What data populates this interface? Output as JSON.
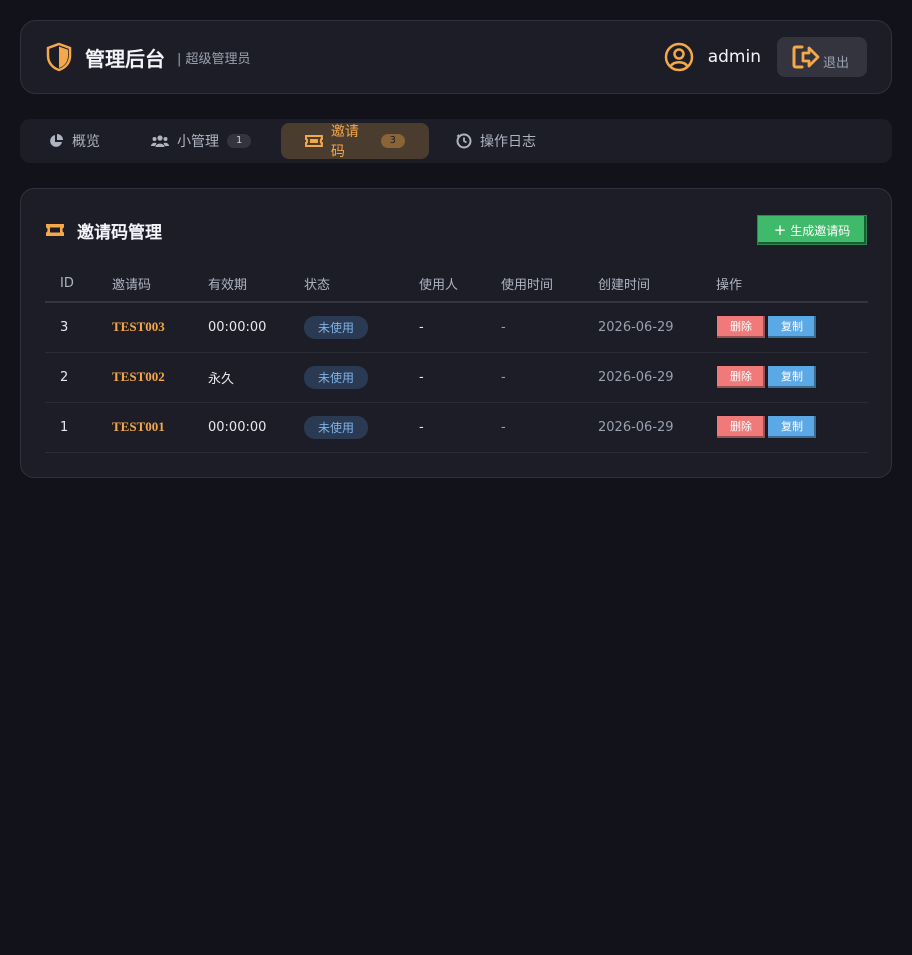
{
  "header": {
    "title": "管理后台",
    "role": "| 超级管理员",
    "username": "admin",
    "logout_label": "退出"
  },
  "tabs": [
    {
      "label": "概览",
      "icon": "pie-chart-icon"
    },
    {
      "label": "小管理",
      "badge": "1",
      "icon": "users-icon"
    },
    {
      "label": "邀请码",
      "badge": "3",
      "icon": "ticket-icon",
      "active": true
    },
    {
      "label": "操作日志",
      "icon": "history-icon"
    }
  ],
  "panel": {
    "title": "邀请码管理",
    "generate_label": "生成邀请码",
    "columns": [
      "ID",
      "邀请码",
      "有效期",
      "状态",
      "使用人",
      "使用时间",
      "创建时间",
      "操作"
    ],
    "rows": [
      {
        "id": "3",
        "code": "TEST003",
        "validity": "00:00:00",
        "status": "未使用",
        "user": "-",
        "used_at": "-",
        "created": "2026-06-29"
      },
      {
        "id": "2",
        "code": "TEST002",
        "validity": "永久",
        "status": "未使用",
        "user": "-",
        "used_at": "-",
        "created": "2026-06-29"
      },
      {
        "id": "1",
        "code": "TEST001",
        "validity": "00:00:00",
        "status": "未使用",
        "user": "-",
        "used_at": "-",
        "created": "2026-06-29"
      }
    ],
    "delete_label": "删除",
    "copy_label": "复制"
  },
  "colors": {
    "accent": "#f4a84a",
    "success": "#3fba6a",
    "danger": "#f07a7a",
    "info": "#5aa8e6",
    "background": "#11121a",
    "panel": "#1c1d26"
  }
}
